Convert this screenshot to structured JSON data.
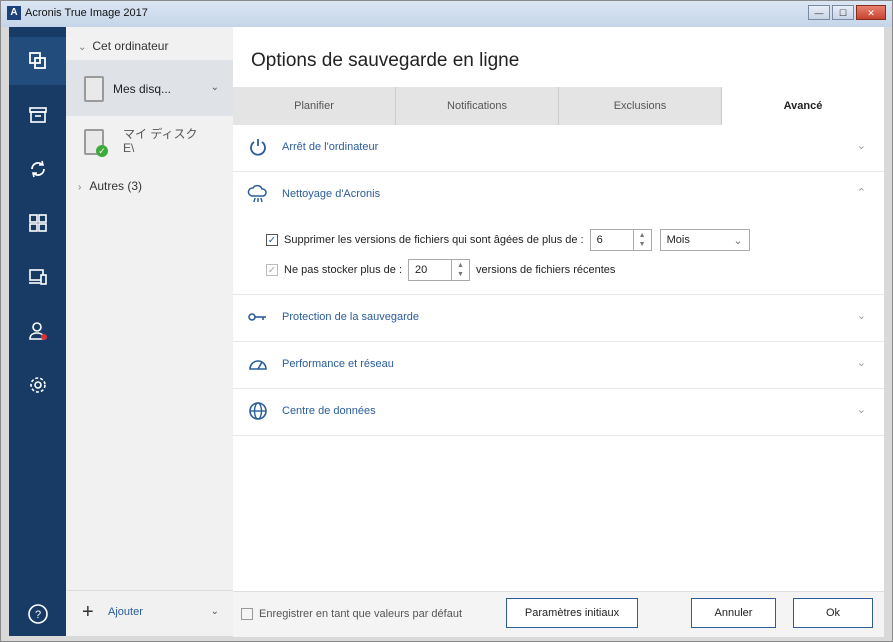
{
  "window": {
    "title": "Acronis True Image 2017",
    "app_icon": "A",
    "buttons": {
      "minimize": "—",
      "maximize": "☐",
      "close": "✕"
    }
  },
  "rail": {
    "items": [
      {
        "icon": "backup-icon"
      },
      {
        "icon": "archive-icon"
      },
      {
        "icon": "sync-icon"
      },
      {
        "icon": "dashboard-icon"
      },
      {
        "icon": "devices-icon"
      },
      {
        "icon": "account-icon"
      },
      {
        "icon": "settings-icon"
      }
    ],
    "help_icon": "help-icon"
  },
  "sources": {
    "header": "Cet ordinateur",
    "items": [
      {
        "label": "Mes disq..."
      },
      {
        "label": "マイ ディスク\nE\\"
      }
    ],
    "others": "Autres (3)",
    "add_label": "Ajouter"
  },
  "main": {
    "title": "Options de sauvegarde en ligne",
    "tabs": [
      {
        "label": "Planifier"
      },
      {
        "label": "Notifications"
      },
      {
        "label": "Exclusions"
      },
      {
        "label": "Avancé"
      }
    ],
    "sections": [
      {
        "label": "Arrêt de l'ordinateur",
        "icon": "power-icon"
      },
      {
        "label": "Nettoyage d'Acronis",
        "icon": "cloud-cleanup-icon"
      },
      {
        "label": "Protection de la sauvegarde",
        "icon": "key-icon"
      },
      {
        "label": "Performance et réseau",
        "icon": "speedometer-icon"
      },
      {
        "label": "Centre de données",
        "icon": "globe-icon"
      }
    ],
    "cleanup": {
      "row1_label": "Supprimer les versions de fichiers qui sont âgées de plus de :",
      "row1_value": "6",
      "row1_unit": "Mois",
      "row2_label": "Ne pas stocker plus de :",
      "row2_value": "20",
      "row2_suffix": "versions de fichiers récentes"
    }
  },
  "footer": {
    "default_label": "Enregistrer en tant que valeurs par défaut",
    "reset_button": "Paramètres initiaux",
    "cancel_button": "Annuler",
    "ok_button": "Ok"
  }
}
